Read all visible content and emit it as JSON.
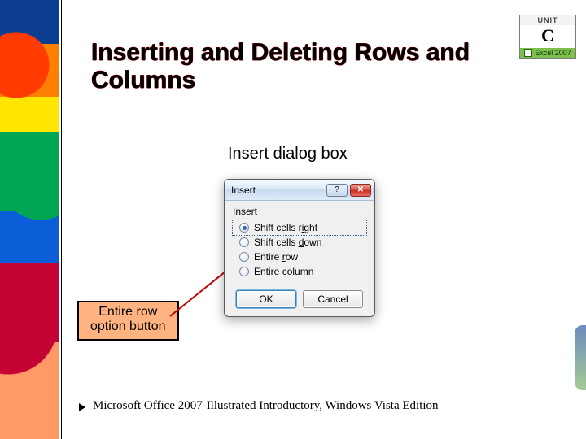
{
  "title": "Inserting and Deleting Rows and Columns",
  "caption": "Insert dialog box",
  "callout": {
    "line1": "Entire row",
    "line2": "option button"
  },
  "unit_badge": {
    "top": "UNIT",
    "letter": "C",
    "product": "Excel 2007"
  },
  "dialog": {
    "title": "Insert",
    "group_label": "Insert",
    "options": [
      {
        "pre": "Shift cells r",
        "u": "i",
        "post": "ght",
        "selected": true,
        "focused": true
      },
      {
        "pre": "Shift cells ",
        "u": "d",
        "post": "own",
        "selected": false,
        "focused": false
      },
      {
        "pre": "Entire ",
        "u": "r",
        "post": "ow",
        "selected": false,
        "focused": false
      },
      {
        "pre": "Entire ",
        "u": "c",
        "post": "olumn",
        "selected": false,
        "focused": false
      }
    ],
    "ok": "OK",
    "cancel": "Cancel",
    "help_tooltip": "Help",
    "close_tooltip": "Close"
  },
  "footer": "Microsoft Office 2007-Illustrated Introductory, Windows Vista Edition"
}
